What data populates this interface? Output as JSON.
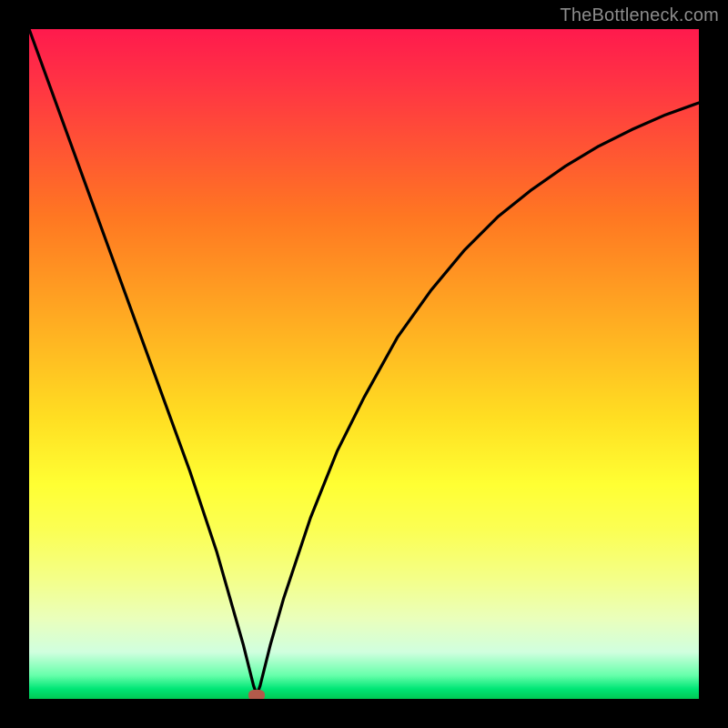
{
  "watermark": "TheBottleneck.com",
  "chart_data": {
    "type": "line",
    "title": "",
    "xlabel": "",
    "ylabel": "",
    "xlim": [
      0,
      100
    ],
    "ylim": [
      0,
      100
    ],
    "series": [
      {
        "name": "curve",
        "x": [
          0,
          4,
          8,
          12,
          16,
          20,
          24,
          28,
          30,
          32,
          33.5,
          34,
          34.5,
          36,
          38,
          42,
          46,
          50,
          55,
          60,
          65,
          70,
          75,
          80,
          85,
          90,
          95,
          100
        ],
        "y": [
          100,
          89,
          78,
          67,
          56,
          45,
          34,
          22,
          15,
          8,
          2,
          0.6,
          2,
          8,
          15,
          27,
          37,
          45,
          54,
          61,
          67,
          72,
          76,
          79.5,
          82.5,
          85,
          87.2,
          89
        ]
      }
    ],
    "marker": {
      "x": 34,
      "y": 0.6
    },
    "background_gradient": [
      "#ff1a4d",
      "#ffde22",
      "#00c853"
    ]
  }
}
